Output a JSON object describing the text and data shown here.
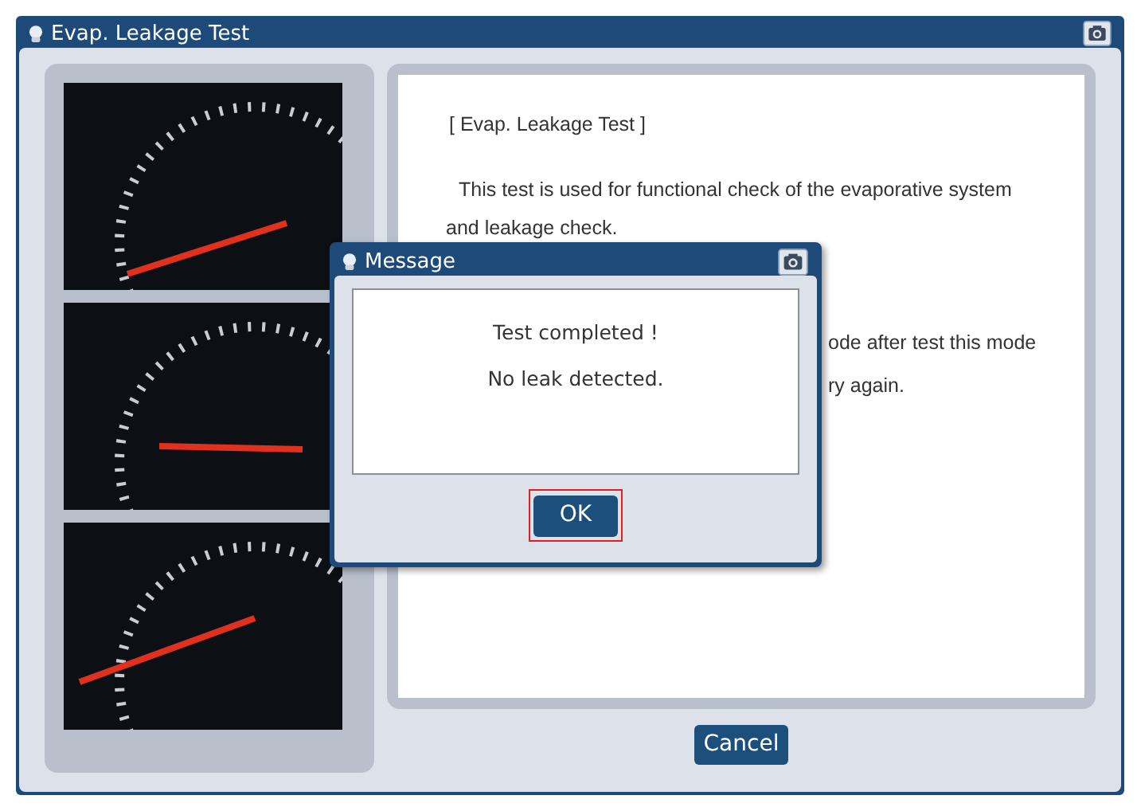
{
  "window": {
    "title": "Evap. Leakage Test"
  },
  "photos": [
    {
      "kind": "speedometer"
    },
    {
      "kind": "tachometer"
    },
    {
      "kind": "gauge"
    }
  ],
  "info": {
    "heading": "[ Evap. Leakage Test ]",
    "lines": [
      "This test is used for functional check of the evaporative system",
      "and leakage check.",
      "ode after test this mode",
      "ry again."
    ]
  },
  "cancel_button": "Cancel",
  "dialog": {
    "title": "Message",
    "lines": [
      "Test completed !",
      "No leak detected."
    ],
    "ok_button": "OK",
    "ok_focused": true
  }
}
